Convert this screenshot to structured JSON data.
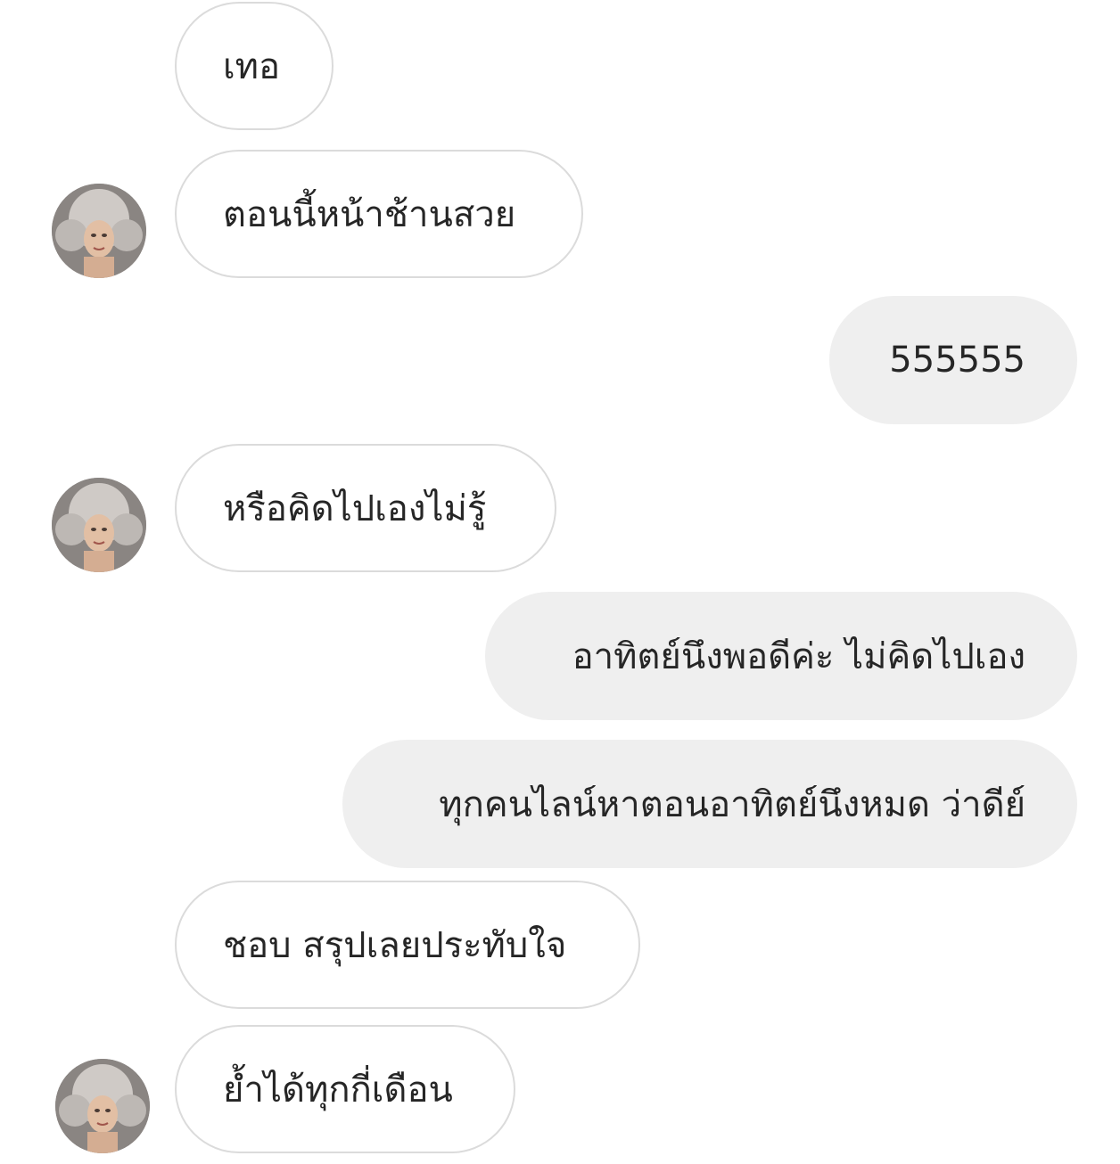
{
  "chat": {
    "messages": [
      {
        "side": "incoming",
        "text": "เทอ"
      },
      {
        "side": "incoming",
        "text": "ตอนนี้หน้าช้านสวย"
      },
      {
        "side": "outgoing",
        "text": "555555"
      },
      {
        "side": "incoming",
        "text": "หรือคิดไปเองไม่รู้"
      },
      {
        "side": "outgoing",
        "text": "อาทิตย์นึงพอดีค่ะ ไม่คิดไปเอง"
      },
      {
        "side": "outgoing",
        "text": "ทุกคนไลน์หาตอนอาทิตย์นึงหมด ว่าดีย์"
      },
      {
        "side": "incoming",
        "text": "ชอบ สรุปเลยประทับใจ"
      },
      {
        "side": "incoming",
        "text": "ย้ำได้ทุกกี่เดือน"
      }
    ],
    "avatar": {
      "icon": "profile-photo",
      "description": "contact-avatar"
    },
    "colors": {
      "incoming_bg": "#ffffff",
      "incoming_border": "#dbdbdb",
      "outgoing_bg": "#efefef",
      "text": "#262626"
    }
  }
}
